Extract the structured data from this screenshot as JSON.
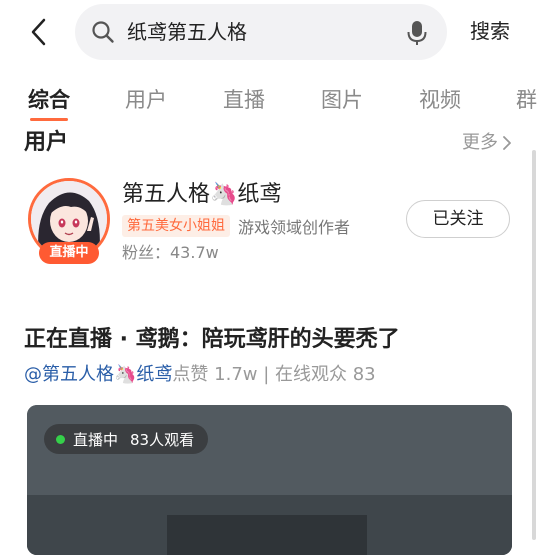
{
  "search": {
    "query": "纸鸢第五人格",
    "button_label": "搜索"
  },
  "tabs": [
    {
      "label": "综合",
      "active": true
    },
    {
      "label": "用户",
      "active": false
    },
    {
      "label": "直播",
      "active": false
    },
    {
      "label": "图片",
      "active": false
    },
    {
      "label": "视频",
      "active": false
    },
    {
      "label": "群",
      "active": false
    }
  ],
  "users_section": {
    "title": "用户",
    "more_label": "更多",
    "user": {
      "name": "第五人格🦄纸鸢",
      "live_badge": "直播中",
      "tag": "第五美女小姐姐",
      "creator_label": "游戏领域创作者",
      "fans": "粉丝：43.7w",
      "follow_label": "已关注"
    }
  },
  "live_item": {
    "title": "正在直播 · 鸢鹅：陪玩鸢肝的头要秃了",
    "author": "@第五人格🦄纸鸢",
    "stats": "点赞 1.7w | 在线观众 83",
    "pill_status": "直播中",
    "pill_viewers": "83人观看"
  },
  "colors": {
    "accent": "#ff6a3d",
    "link": "#2a5ea8",
    "live_dot": "#35d04a"
  }
}
